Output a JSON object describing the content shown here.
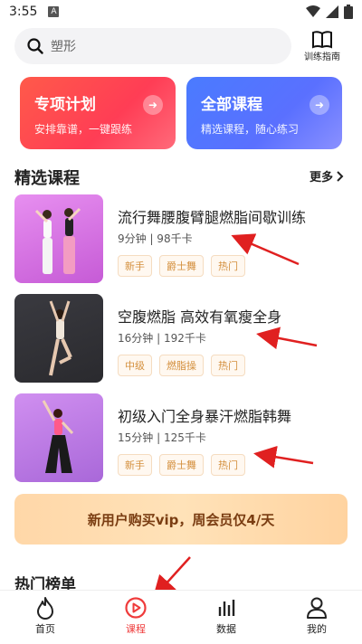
{
  "status_bar": {
    "time": "3:55",
    "notif": "A"
  },
  "search": {
    "placeholder": "塑形"
  },
  "guide": {
    "label": "训练指南"
  },
  "promos": [
    {
      "title": "专项计划",
      "subtitle": "安排靠谱，一键跟练"
    },
    {
      "title": "全部课程",
      "subtitle": "精选课程，随心练习"
    }
  ],
  "section": {
    "title": "精选课程",
    "more": "更多"
  },
  "courses": [
    {
      "title": "流行舞腰腹臂腿燃脂间歇训练",
      "meta": "9分钟 | 98千卡",
      "tags": [
        "新手",
        "爵士舞",
        "热门"
      ]
    },
    {
      "title": "空腹燃脂 高效有氧瘦全身",
      "meta": "16分钟 | 192千卡",
      "tags": [
        "中级",
        "燃脂操",
        "热门"
      ]
    },
    {
      "title": "初级入门全身暴汗燃脂韩舞",
      "meta": "15分钟 | 125千卡",
      "tags": [
        "新手",
        "爵士舞",
        "热门"
      ]
    }
  ],
  "vip": {
    "text": "新用户购买vip，周会员仅4/天"
  },
  "hot": {
    "title": "热门榜单"
  },
  "tabs": [
    {
      "label": "首页",
      "icon": "flame-icon"
    },
    {
      "label": "课程",
      "icon": "play-circle-icon"
    },
    {
      "label": "数据",
      "icon": "bar-chart-icon"
    },
    {
      "label": "我的",
      "icon": "user-icon"
    }
  ],
  "colors": {
    "accent": "#ef3b3b",
    "promo_red": "#ff4a50",
    "promo_blue": "#4f72ff",
    "tag": "#d4903e",
    "vip_text": "#7a3d12"
  }
}
